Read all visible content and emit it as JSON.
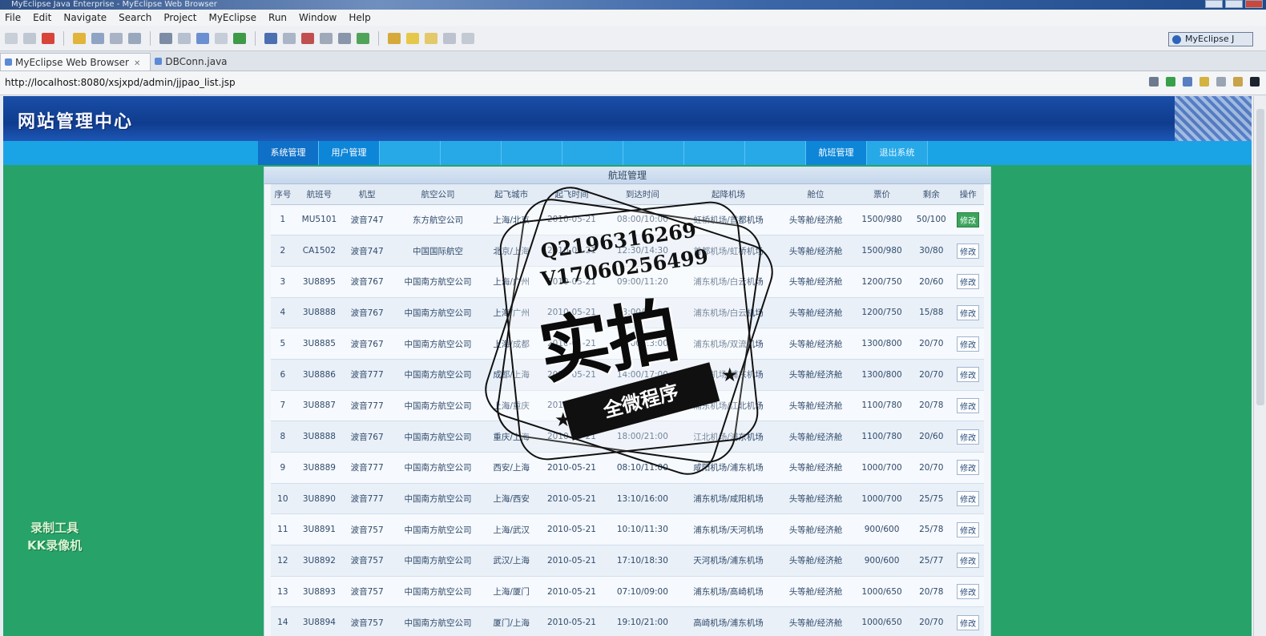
{
  "window": {
    "title": "MyEclipse Java Enterprise - MyEclipse Web Browser"
  },
  "menu": [
    "File",
    "Edit",
    "Navigate",
    "Search",
    "Project",
    "MyEclipse",
    "Run",
    "Window",
    "Help"
  ],
  "perspective": {
    "label": "MyEclipse J"
  },
  "editor_tabs": [
    {
      "label": "MyEclipse Web Browser"
    },
    {
      "label": "DBConn.java"
    }
  ],
  "address": {
    "url": "http://localhost:8080/xsjxpd/admin/jjpao_list.jsp"
  },
  "site": {
    "logo": "网站管理中心",
    "nav": [
      "系统管理",
      "用户管理",
      "",
      "",
      "",
      "",
      "",
      "",
      "",
      "航班管理",
      "退出系统"
    ],
    "badge_line1": "录制工具",
    "badge_line2": "KK录像机"
  },
  "panel": {
    "title": "航班管理"
  },
  "table": {
    "columns": [
      "序号",
      "航班号",
      "机型",
      "航空公司",
      "起飞城市",
      "起飞时间",
      "到达时间",
      "起降机场",
      "舱位",
      "票价",
      "剩余",
      "操作"
    ],
    "rows": [
      [
        "1",
        "MU5101",
        "波音747",
        "东方航空公司",
        "上海/北京",
        "2010-05-21",
        "08:00/10:00",
        "虹桥机场/首都机场",
        "头等舱/经济舱",
        "1500/980",
        "50/100",
        "修改"
      ],
      [
        "2",
        "CA1502",
        "波音747",
        "中国国际航空",
        "北京/上海",
        "2010-05-21",
        "12:30/14:30",
        "首都机场/虹桥机场",
        "头等舱/经济舱",
        "1500/980",
        "30/80",
        "修改"
      ],
      [
        "3",
        "3U8895",
        "波音767",
        "中国南方航空公司",
        "上海/广州",
        "2010-05-21",
        "09:00/11:20",
        "浦东机场/白云机场",
        "头等舱/经济舱",
        "1200/750",
        "20/60",
        "修改"
      ],
      [
        "4",
        "3U8888",
        "波音767",
        "中国南方航空公司",
        "上海/广州",
        "2010-05-21",
        "13:00/15:20",
        "浦东机场/白云机场",
        "头等舱/经济舱",
        "1200/750",
        "15/88",
        "修改"
      ],
      [
        "5",
        "3U8885",
        "波音767",
        "中国南方航空公司",
        "上海/成都",
        "2010-05-21",
        "10:00/13:00",
        "浦东机场/双流机场",
        "头等舱/经济舱",
        "1300/800",
        "20/70",
        "修改"
      ],
      [
        "6",
        "3U8886",
        "波音777",
        "中国南方航空公司",
        "成都/上海",
        "2010-05-21",
        "14:00/17:00",
        "双流机场/浦东机场",
        "头等舱/经济舱",
        "1300/800",
        "20/70",
        "修改"
      ],
      [
        "7",
        "3U8887",
        "波音777",
        "中国南方航空公司",
        "上海/重庆",
        "2010-05-21",
        "15:00/17:00",
        "浦东机场/江北机场",
        "头等舱/经济舱",
        "1100/780",
        "20/78",
        "修改"
      ],
      [
        "8",
        "3U8888",
        "波音767",
        "中国南方航空公司",
        "重庆/上海",
        "2010-05-21",
        "18:00/21:00",
        "江北机场/浦东机场",
        "头等舱/经济舱",
        "1100/780",
        "20/60",
        "修改"
      ],
      [
        "9",
        "3U8889",
        "波音777",
        "中国南方航空公司",
        "西安/上海",
        "2010-05-21",
        "08:10/11:00",
        "咸阳机场/浦东机场",
        "头等舱/经济舱",
        "1000/700",
        "20/70",
        "修改"
      ],
      [
        "10",
        "3U8890",
        "波音777",
        "中国南方航空公司",
        "上海/西安",
        "2010-05-21",
        "13:10/16:00",
        "浦东机场/咸阳机场",
        "头等舱/经济舱",
        "1000/700",
        "25/75",
        "修改"
      ],
      [
        "11",
        "3U8891",
        "波音757",
        "中国南方航空公司",
        "上海/武汉",
        "2010-05-21",
        "10:10/11:30",
        "浦东机场/天河机场",
        "头等舱/经济舱",
        "900/600",
        "25/78",
        "修改"
      ],
      [
        "12",
        "3U8892",
        "波音757",
        "中国南方航空公司",
        "武汉/上海",
        "2010-05-21",
        "17:10/18:30",
        "天河机场/浦东机场",
        "头等舱/经济舱",
        "900/600",
        "25/77",
        "修改"
      ],
      [
        "13",
        "3U8893",
        "波音757",
        "中国南方航空公司",
        "上海/厦门",
        "2010-05-21",
        "07:10/09:00",
        "浦东机场/高崎机场",
        "头等舱/经济舱",
        "1000/650",
        "20/78",
        "修改"
      ],
      [
        "14",
        "3U8894",
        "波音757",
        "中国南方航空公司",
        "厦门/上海",
        "2010-05-21",
        "19:10/21:00",
        "高崎机场/浦东机场",
        "头等舱/经济舱",
        "1000/650",
        "20/70",
        "修改"
      ]
    ]
  },
  "watermark": {
    "qq": "Q2196316269",
    "vx": "V17060256499",
    "main": "实拍",
    "ribbon": "全微程序"
  },
  "colors": {
    "page_bg": "#27a36a",
    "header_blue": "#1a4ea8",
    "nav_blue": "#1aa4e6"
  }
}
